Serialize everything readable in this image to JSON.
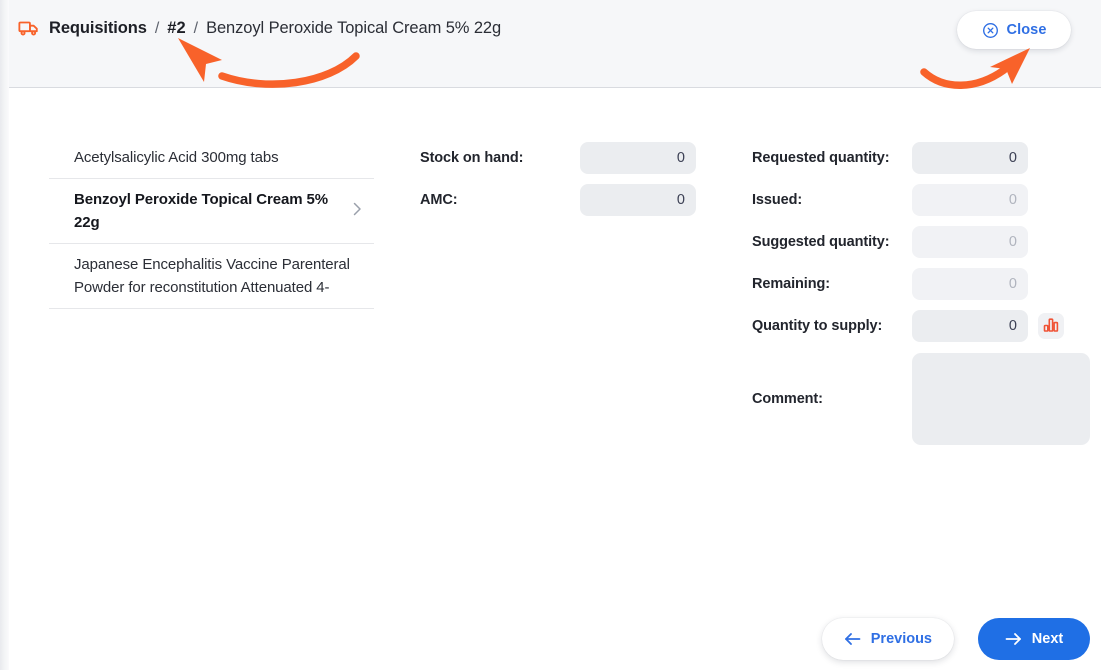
{
  "header": {
    "truck_icon": "truck-icon",
    "breadcrumb": {
      "root": "Requisitions",
      "separator": "/",
      "id": "#2",
      "leaf": "Benzoyl Peroxide Topical Cream 5% 22g"
    },
    "close_button": {
      "label": "Close",
      "icon": "close-circle-icon"
    }
  },
  "annotations": [
    {
      "name": "arrow-to-breadcrumb-id",
      "color": "#f8622a"
    },
    {
      "name": "arrow-to-close-button",
      "color": "#f8622a"
    }
  ],
  "item_list": [
    {
      "label": "Acetylsalicylic Acid 300mg tabs",
      "selected": false
    },
    {
      "label": "Benzoyl Peroxide Topical Cream 5% 22g",
      "selected": true
    },
    {
      "label": "Japanese Encephalitis Vaccine Parenteral Powder for reconstitution Attenuated 4-",
      "selected": false
    }
  ],
  "form": {
    "middle": [
      {
        "label": "Stock on hand:",
        "value": "0",
        "disabled": false
      },
      {
        "label": "AMC:",
        "value": "0",
        "disabled": false
      }
    ],
    "right": [
      {
        "label": "Requested quantity:",
        "value": "0",
        "disabled": false
      },
      {
        "label": "Issued:",
        "value": "0",
        "disabled": true
      },
      {
        "label": "Suggested quantity:",
        "value": "0",
        "disabled": true
      },
      {
        "label": "Remaining:",
        "value": "0",
        "disabled": true
      },
      {
        "label": "Quantity to supply:",
        "value": "0",
        "disabled": false
      }
    ],
    "chart_button_icon": "bar-chart-icon",
    "comment": {
      "label": "Comment:",
      "value": "",
      "placeholder": ""
    }
  },
  "footer": {
    "previous_label": "Previous",
    "previous_icon": "arrow-left-icon",
    "next_label": "Next",
    "next_icon": "arrow-right-icon"
  },
  "colors": {
    "accent_blue": "#1f6fe5",
    "accent_orange": "#f8622a",
    "header_bg": "#f6f7f9",
    "input_bg": "#ebedf0"
  }
}
